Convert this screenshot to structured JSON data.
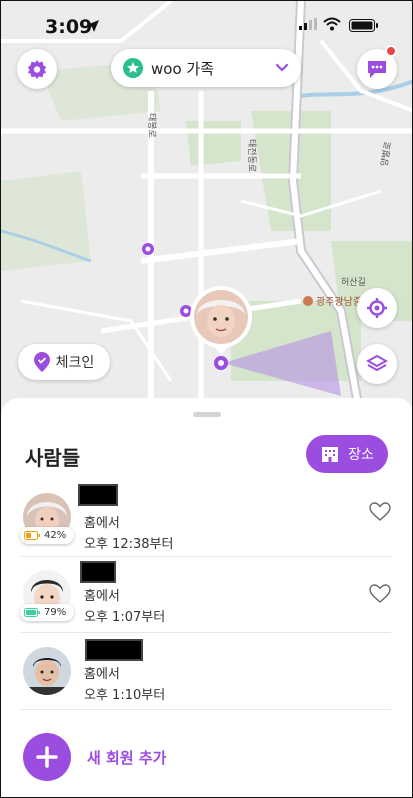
{
  "status_bar": {
    "time": "3:09"
  },
  "map": {
    "group_name": "woo 가족",
    "checkin_label": "체크인",
    "labels": {
      "road_left": "태봉로",
      "road_center": "태전동로",
      "road_right": "양벌로",
      "road_bottom": "허산길",
      "poi": "광주광남중"
    }
  },
  "people": {
    "title": "사람들",
    "places_button": "장소",
    "members": [
      {
        "status": "홈에서",
        "since": "오후 12:38부터",
        "battery": "42%"
      },
      {
        "status": "홈에서",
        "since": "오후 1:07부터",
        "battery": "79%"
      },
      {
        "status": "홈에서",
        "since": "오후 1:10부터"
      }
    ],
    "add_member_label": "새 회원 추가"
  },
  "colors": {
    "accent": "#9b4de0",
    "map_background": "#ececec",
    "park_green": "#cfe3c4",
    "road": "#ffffff",
    "battery_low": "#f59e0b",
    "battery_ok": "#3ecf9c",
    "notification": "#ef4444"
  },
  "icons": {
    "settings": "gear-icon",
    "chat": "chat-icon",
    "locate": "locate-icon",
    "layers": "layers-icon",
    "checkin": "checkin-pin-icon",
    "places": "building-icon",
    "favorite": "heart-icon",
    "add": "plus-icon"
  }
}
